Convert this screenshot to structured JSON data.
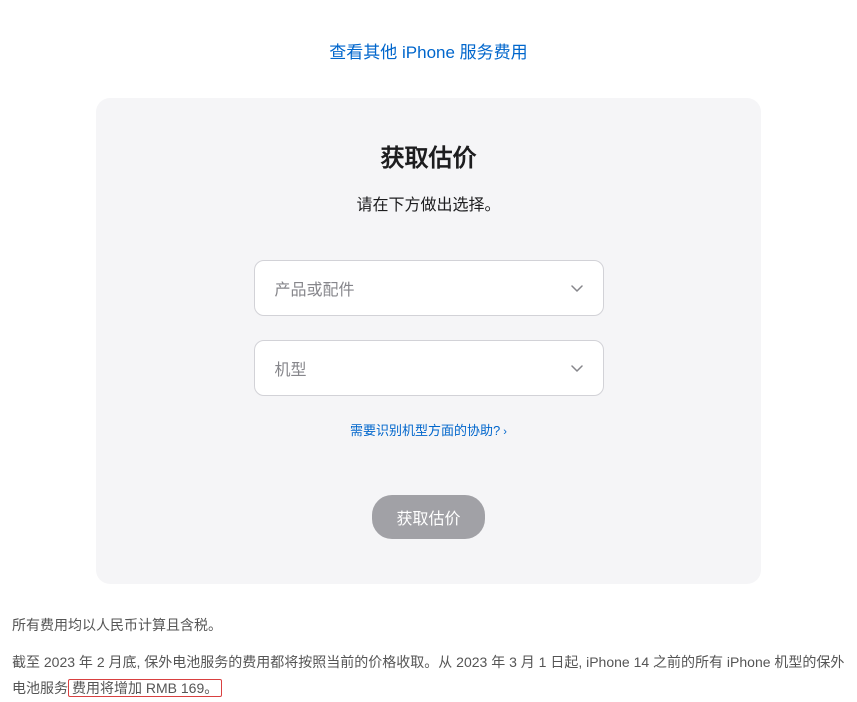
{
  "topLink": {
    "text": "查看其他 iPhone 服务费用"
  },
  "card": {
    "title": "获取估价",
    "subtitle": "请在下方做出选择。",
    "select1": {
      "placeholder": "产品或配件"
    },
    "select2": {
      "placeholder": "机型"
    },
    "helpLink": {
      "text": "需要识别机型方面的协助?",
      "arrow": "›"
    },
    "submitButton": "获取估价"
  },
  "footer": {
    "line1": "所有费用均以人民币计算且含税。",
    "line2_part1": "截至 2023 年 2 月底, 保外电池服务的费用都将按照当前的价格收取。从 2023 年 3 月 1 日起, iPhone 14 之前的所有 iPhone 机型的保外电池服务",
    "line2_highlight": "费用将增加 RMB 169。"
  }
}
